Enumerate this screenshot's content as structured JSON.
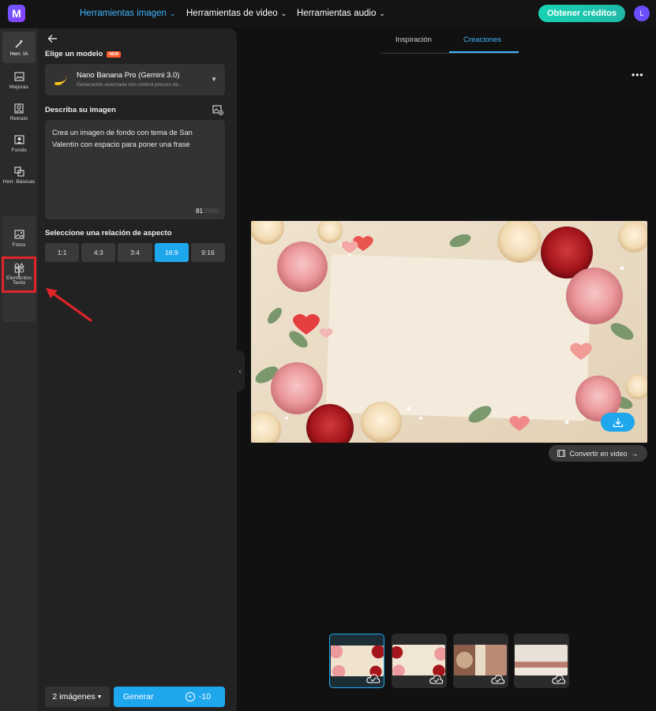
{
  "app": {
    "logo_letter": "M",
    "accent": "#1fa7ee",
    "brand": "#6a5cff"
  },
  "topnav": {
    "items": [
      {
        "label": "Herramientas imagen",
        "active": true
      },
      {
        "label": "Herramientas de video",
        "active": false
      },
      {
        "label": "Herramientas audio",
        "active": false
      }
    ],
    "credits_button": "Obtener créditos",
    "avatar_letter": "L"
  },
  "rail": {
    "items": [
      {
        "label": "Herr. IA",
        "icon": "magic-wand-icon",
        "active": true
      },
      {
        "label": "Mejoras",
        "icon": "enhance-image-icon"
      },
      {
        "label": "Retrato",
        "icon": "portrait-icon"
      },
      {
        "label": "Fondo",
        "icon": "background-icon"
      },
      {
        "label": "Herr. Básicas",
        "icon": "crop-icon"
      },
      {
        "label": "Fotos",
        "icon": "photos-icon"
      },
      {
        "label": "Elementos",
        "icon": "elements-icon"
      },
      {
        "label": "Texto",
        "icon": "text-icon"
      }
    ]
  },
  "panel": {
    "model_section_label": "Elige un modelo",
    "new_badge": "NEW",
    "model": {
      "name": "Nano Banana Pro (Gemini 3.0)",
      "description": "Generación avanzada con control preciso de..."
    },
    "prompt_section_label": "Describa su imagen",
    "prompt_text": "Crea un imagen de fondo con tema de San Valentín con espacio para poner una frase",
    "char_count": "81",
    "char_max": "/2000",
    "aspect_section_label": "Seleccione una relación de aspecto",
    "aspect_ratios": [
      {
        "label": "1:1",
        "active": false
      },
      {
        "label": "4:3",
        "active": false
      },
      {
        "label": "3:4",
        "active": false
      },
      {
        "label": "16:9",
        "active": true
      },
      {
        "label": "9:16",
        "active": false
      }
    ],
    "image_count": "2 imágenes",
    "generate_label": "Generar",
    "generate_cost": "-10"
  },
  "main": {
    "tabs": [
      {
        "label": "Inspiración",
        "active": false
      },
      {
        "label": "Creaciones",
        "active": true
      }
    ],
    "convert_label": "Convertir en video",
    "thumbnails": [
      {
        "selected": true
      },
      {
        "selected": false
      },
      {
        "selected": false
      },
      {
        "selected": false
      }
    ]
  }
}
